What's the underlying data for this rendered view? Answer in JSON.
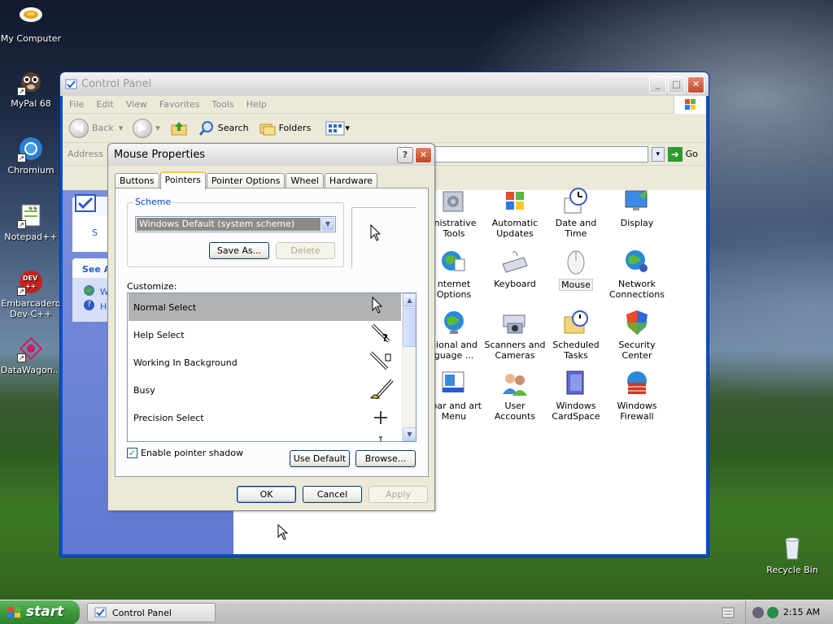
{
  "desktop": {
    "icons": [
      {
        "label": "My Computer"
      },
      {
        "label": "MyPal 68"
      },
      {
        "label": "Chromium"
      },
      {
        "label": "Notepad++"
      },
      {
        "label": "Embarcadero Dev-C++"
      },
      {
        "label": "DataWagon..."
      },
      {
        "label": "Recycle Bin"
      }
    ]
  },
  "control_panel": {
    "title": "Control Panel",
    "menu": [
      "File",
      "Edit",
      "View",
      "Favorites",
      "Tools",
      "Help"
    ],
    "toolbar": {
      "back": "Back",
      "search": "Search",
      "folders": "Folders"
    },
    "address_label": "Address",
    "go_label": "Go",
    "left_pane": {
      "see_also_fragment": "See A",
      "item1_fragment": "S",
      "item2_fragment": "W",
      "item3_fragment": "H"
    },
    "items": [
      {
        "label": "inistrative Tools"
      },
      {
        "label": "Automatic Updates"
      },
      {
        "label": "Date and Time"
      },
      {
        "label": "Display"
      },
      {
        "label": "nternet Options"
      },
      {
        "label": "Keyboard"
      },
      {
        "label": "Mouse"
      },
      {
        "label": "Network Connections"
      },
      {
        "label": "gional and guage ..."
      },
      {
        "label": "Scanners and Cameras"
      },
      {
        "label": "Scheduled Tasks"
      },
      {
        "label": "Security Center"
      },
      {
        "label": "kbar and art Menu"
      },
      {
        "label": "User Accounts"
      },
      {
        "label": "Windows CardSpace"
      },
      {
        "label": "Windows Firewall"
      }
    ]
  },
  "dialog": {
    "title": "Mouse Properties",
    "help_label": "?",
    "close_label": "✕",
    "tabs": [
      "Buttons",
      "Pointers",
      "Pointer Options",
      "Wheel",
      "Hardware"
    ],
    "active_tab": "Pointers",
    "scheme_label": "Scheme",
    "scheme_value": "Windows Default (system scheme)",
    "save_as_label": "Save As...",
    "delete_label": "Delete",
    "customize_label": "Customize:",
    "pointers": [
      {
        "name": "Normal Select",
        "selected": true
      },
      {
        "name": "Help Select",
        "selected": false
      },
      {
        "name": "Working In Background",
        "selected": false
      },
      {
        "name": "Busy",
        "selected": false
      },
      {
        "name": "Precision Select",
        "selected": false
      }
    ],
    "enable_shadow_label": "Enable pointer shadow",
    "enable_shadow_checked": true,
    "use_default_label": "Use Default",
    "browse_label": "Browse...",
    "ok_label": "OK",
    "cancel_label": "Cancel",
    "apply_label": "Apply"
  },
  "taskbar": {
    "start_label": "start",
    "task_label": "Control Panel",
    "time": "2:15 AM"
  },
  "colors": {
    "titlebar_inactive": "#d4d4d4",
    "start_green": "#3c983c",
    "selection_gray": "#b2b2b2"
  }
}
